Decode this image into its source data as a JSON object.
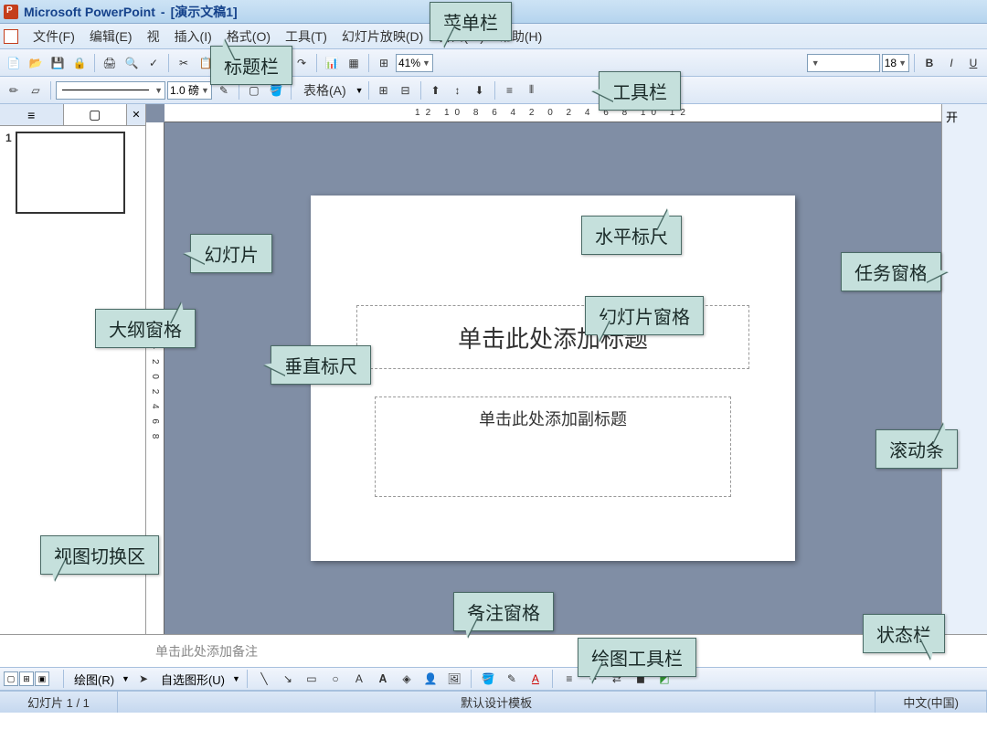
{
  "titlebar": {
    "app": "Microsoft PowerPoint",
    "doc": "[演示文稿1]"
  },
  "menu": {
    "file": "文件(F)",
    "edit": "编辑(E)",
    "view": "视",
    "insert": "插入(I)",
    "format": "格式(O)",
    "tools": "工具(T)",
    "slideshow": "幻灯片放映(D)",
    "window": "窗口(W)",
    "help": "帮助(H)"
  },
  "toolbar1": {
    "zoom": "41%",
    "fontsize": "18"
  },
  "toolbar2": {
    "lineweight": "1.0 磅",
    "table": "表格(A)"
  },
  "outline": {
    "slide_num": "1"
  },
  "ruler_h": "12 10 8 6 4 2 0 2 4 6 8 10 12",
  "ruler_v": "8 6 4 2 0 2 4 6 8",
  "slide": {
    "title_placeholder": "单击此处添加标题",
    "subtitle_placeholder": "单击此处添加副标题"
  },
  "notes": {
    "placeholder": "单击此处添加备注"
  },
  "drawbar": {
    "label": "绘图(R)",
    "autoshape": "自选图形(U)"
  },
  "status": {
    "slide": "幻灯片 1 / 1",
    "template": "默认设计模板",
    "lang": "中文(中国)"
  },
  "callouts": {
    "menubar": "菜单栏",
    "titlebar": "标题栏",
    "toolbar": "工具栏",
    "hruler": "水平标尺",
    "taskpane": "任务窗格",
    "slide": "幻灯片",
    "outline": "大纲窗格",
    "vruler": "垂直标尺",
    "slidepane": "幻灯片窗格",
    "scrollbar": "滚动条",
    "viewswitch": "视图切换区",
    "notes": "备注窗格",
    "drawbar": "绘图工具栏",
    "statusbar": "状态栏"
  },
  "taskpane_char": "开"
}
